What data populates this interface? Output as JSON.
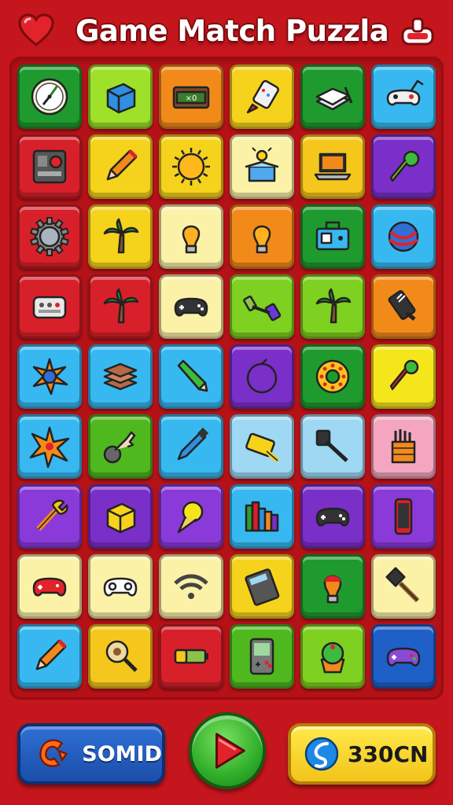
{
  "header": {
    "title": "Game Match Puzzla",
    "heart_icon": "heart-icon",
    "settings_icon": "toggle-icon"
  },
  "board": {
    "rows": [
      [
        {
          "icon": "compass-icon",
          "color": "#1f9a2e"
        },
        {
          "icon": "blue-cube-icon",
          "color": "#9ee02a"
        },
        {
          "icon": "cash-box-icon",
          "color": "#f28a1a"
        },
        {
          "icon": "glue-bottle-icon",
          "color": "#f5d21c"
        },
        {
          "icon": "paper-stack-icon",
          "color": "#1f9a2e"
        },
        {
          "icon": "controller-arm-icon",
          "color": "#38b8f0"
        }
      ],
      [
        {
          "icon": "device-panel-icon",
          "color": "#d8202a"
        },
        {
          "icon": "pencil-icon",
          "color": "#f5d21c"
        },
        {
          "icon": "sun-gear-icon",
          "color": "#f5d21c"
        },
        {
          "icon": "lamp-box-icon",
          "color": "#fbf2a8"
        },
        {
          "icon": "laptop-icon",
          "color": "#f5c61c"
        },
        {
          "icon": "green-pen-icon",
          "color": "#7a2fc8"
        }
      ],
      [
        {
          "icon": "gear-icon",
          "color": "#d8202a"
        },
        {
          "icon": "palm-tree-icon",
          "color": "#f5d21c"
        },
        {
          "icon": "lightbulb-icon",
          "color": "#fbf2a8"
        },
        {
          "icon": "lightbulb-icon",
          "color": "#f28a1a"
        },
        {
          "icon": "toolbox-icon",
          "color": "#1f9a2e"
        },
        {
          "icon": "yarn-ball-icon",
          "color": "#38b8f0"
        }
      ],
      [
        {
          "icon": "keypad-icon",
          "color": "#d8202a"
        },
        {
          "icon": "palm-tree-icon",
          "color": "#d8202a"
        },
        {
          "icon": "gamepad-icon",
          "color": "#fbf2a8"
        },
        {
          "icon": "dumbbell-icon",
          "color": "#7ed021"
        },
        {
          "icon": "palm-tree-icon",
          "color": "#7ed021"
        },
        {
          "icon": "usb-drive-icon",
          "color": "#f28a1a"
        }
      ],
      [
        {
          "icon": "spiky-ball-icon",
          "color": "#38b8f0"
        },
        {
          "icon": "book-stack-icon",
          "color": "#38b8f0"
        },
        {
          "icon": "green-pencil-icon",
          "color": "#38b8f0"
        },
        {
          "icon": "plum-icon",
          "color": "#7a2fc8"
        },
        {
          "icon": "donut-icon",
          "color": "#1f9a2e"
        },
        {
          "icon": "marker-icon",
          "color": "#f5e61c"
        }
      ],
      [
        {
          "icon": "star-burst-icon",
          "color": "#38b8f0"
        },
        {
          "icon": "hand-knob-icon",
          "color": "#4fb81f"
        },
        {
          "icon": "blue-marker-icon",
          "color": "#38b8f0"
        },
        {
          "icon": "tape-measure-icon",
          "color": "#9ed8f2"
        },
        {
          "icon": "spatula-icon",
          "color": "#9ed8f2"
        },
        {
          "icon": "pencil-cup-icon",
          "color": "#f4a6c0"
        }
      ],
      [
        {
          "icon": "wrench-icon",
          "color": "#8a3ad8"
        },
        {
          "icon": "yellow-box-icon",
          "color": "#7a2fc8"
        },
        {
          "icon": "ice-cream-icon",
          "color": "#8a3ad8"
        },
        {
          "icon": "books-icon",
          "color": "#38b8f0"
        },
        {
          "icon": "gamepad-icon",
          "color": "#7a2fc8"
        },
        {
          "icon": "smartphone-icon",
          "color": "#8a3ad8"
        }
      ],
      [
        {
          "icon": "red-gamepad-icon",
          "color": "#fbf2a8"
        },
        {
          "icon": "gamepad-outline-icon",
          "color": "#fbf2a8"
        },
        {
          "icon": "wifi-icon",
          "color": "#fbf2a8"
        },
        {
          "icon": "calculator-icon",
          "color": "#f5d21c"
        },
        {
          "icon": "lightbulb-red-icon",
          "color": "#1f9a2e"
        },
        {
          "icon": "trowel-icon",
          "color": "#fbf2a8"
        }
      ],
      [
        {
          "icon": "pencil-icon",
          "color": "#38b8f0"
        },
        {
          "icon": "magnifier-icon",
          "color": "#f5c61c"
        },
        {
          "icon": "battery-icon",
          "color": "#d8202a"
        },
        {
          "icon": "handheld-console-icon",
          "color": "#4fb81f"
        },
        {
          "icon": "cupcake-icon",
          "color": "#7ed021"
        },
        {
          "icon": "purple-gamepad-icon",
          "color": "#1f5fc8"
        }
      ]
    ]
  },
  "footer": {
    "sound_label": "SOMID",
    "coins_label": "330CN",
    "play_icon": "play-icon"
  }
}
